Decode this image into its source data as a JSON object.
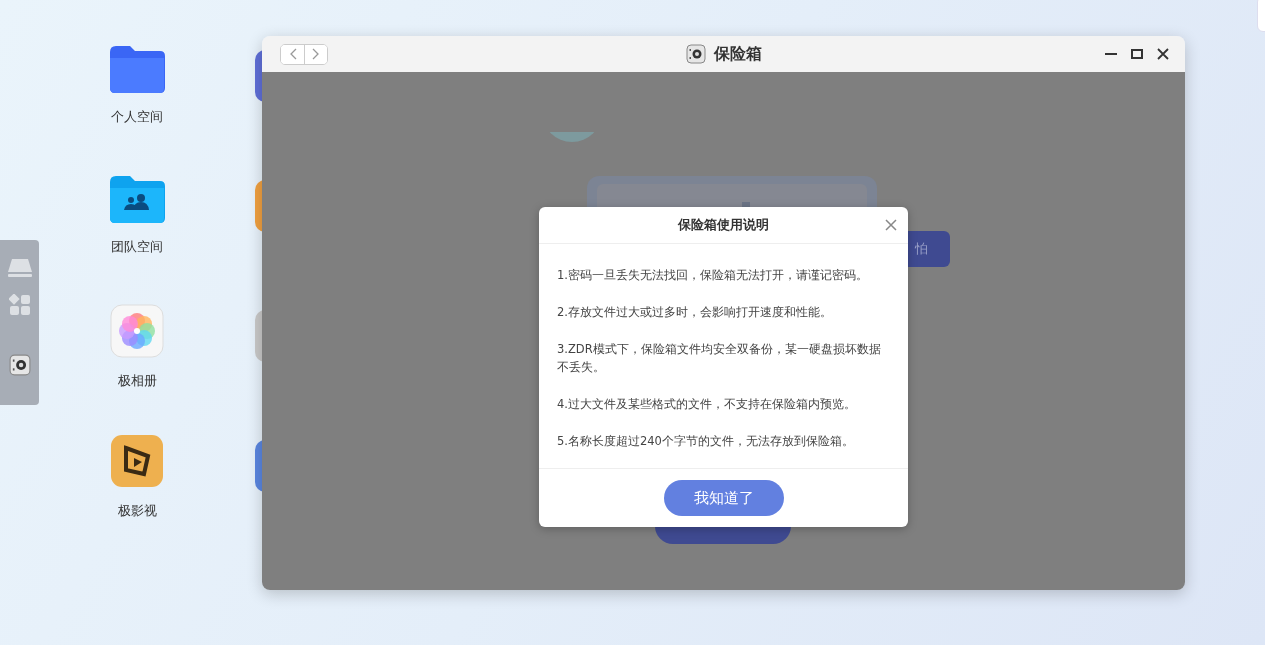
{
  "desktop_icons": [
    {
      "kind": "folder",
      "label": "个人空间"
    },
    {
      "kind": "team",
      "label": "团队空间"
    },
    {
      "kind": "photos",
      "label": "极相册"
    },
    {
      "kind": "video",
      "label": "极影视"
    }
  ],
  "window": {
    "title": "保险箱"
  },
  "background_button": {
    "label": "怕"
  },
  "dialog": {
    "title": "保险箱使用说明",
    "items": [
      "1.密码一旦丢失无法找回，保险箱无法打开，请谨记密码。",
      "2.存放文件过大或过多时，会影响打开速度和性能。",
      "3.ZDR模式下，保险箱文件均安全双备份，某一硬盘损坏数据不丢失。",
      "4.过大文件及某些格式的文件，不支持在保险箱内预览。",
      "5.名称长度超过240个字节的文件，无法存放到保险箱。"
    ],
    "button": "我知道了"
  }
}
